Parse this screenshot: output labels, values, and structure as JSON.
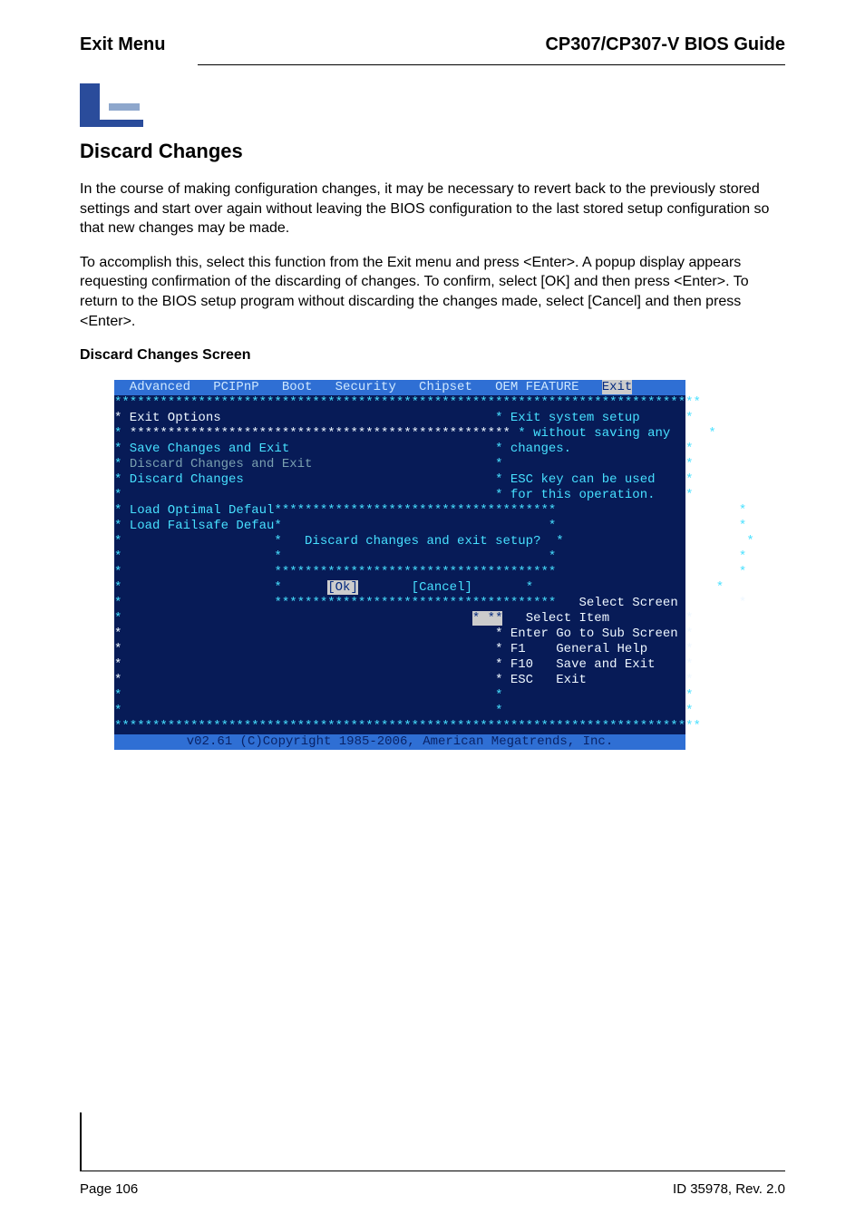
{
  "header": {
    "left": "Exit Menu",
    "right": "CP307/CP307-V BIOS Guide"
  },
  "section_title": "Discard Changes",
  "para1": "In the course of making configuration changes, it may be necessary to revert back to the previously stored settings and start over again without leaving the BIOS configuration to the last stored setup configuration so that new changes may be made.",
  "para2": "To accomplish this, select this function from the Exit menu and press <Enter>. A popup display appears requesting confirmation of the discarding of changes. To confirm, select [OK] and then press <Enter>. To return to the BIOS setup program without discarding the changes made, select [Cancel] and then press <Enter>.",
  "sub_title": "Discard Changes Screen",
  "bios": {
    "tabs_text": "  Advanced   PCIPnP   Boot   Security   Chipset   OEM FEATURE   ",
    "tab_exit": "Exit",
    "r1": "*****************************************************************************",
    "r2a": "* Exit Options",
    "r2b": "                                    * Exit system setup      *",
    "r3a": "* ",
    "r3b": "**************************************************",
    "r3c": " * without saving any     *",
    "r4a": "* Save Changes and Exit",
    "r4b": "                           * changes.               *",
    "r5a": "* ",
    "r5b": "Discard Changes and Exit",
    "r5c": "                        *                        *",
    "r6a": "* Discard Changes",
    "r6b": "                                 * ESC key can be used    *",
    "r7a": "*",
    "r7b": "                                                 * for this operation.    *",
    "r8a": "* Load Optimal Defaul",
    "r8b": "*************************************                        *",
    "r9a": "* Load Failsafe Defau*",
    "r9b": "                                   *                        *",
    "r10a": "*                    *   Discard changes and exit setup?  *                        *",
    "r11": "*                    *                                   *                        *",
    "r12a": "*                    ",
    "r12b": "*************************************                        *",
    "r13a": "*                    *      ",
    "r13ok": "[Ok]",
    "r13b": "       [Cancel]       *                        *",
    "r14a": "*                    ",
    "r14b": "*************************************",
    "r14c": "   Select Screen        *",
    "r15a": "*                                              ",
    "r15sel": "* **",
    "r15b": "   Select Item          *",
    "r16": "*                                                 * Enter Go to Sub Screen *",
    "r17": "*                                                 * F1    General Help     *",
    "r18": "*                                                 * F10   Save and Exit    *",
    "r19": "*                                                 * ESC   Exit             *",
    "r20": "*                                                 *                        *",
    "r21": "*                                                 *                        *",
    "r22": "*****************************************************************************",
    "footer": "v02.61 (C)Copyright 1985-2006, American Megatrends, Inc."
  },
  "page_footer": {
    "left": "Page 106",
    "right": "ID 35978, Rev. 2.0"
  }
}
